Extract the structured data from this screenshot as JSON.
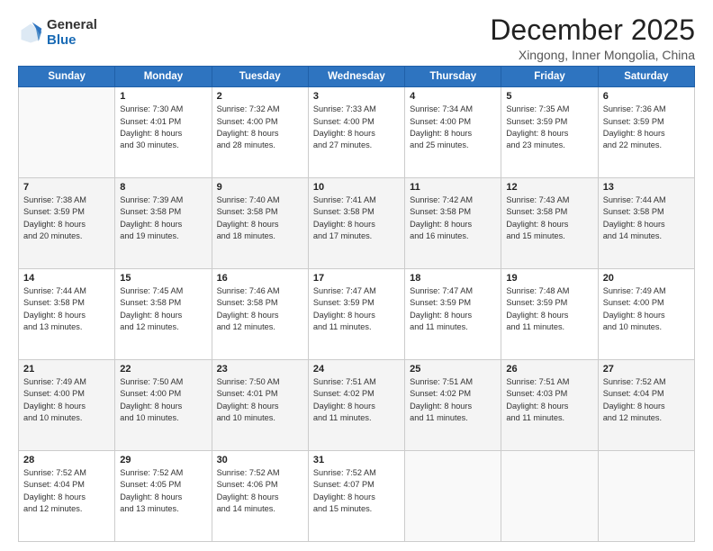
{
  "logo": {
    "general": "General",
    "blue": "Blue"
  },
  "title": "December 2025",
  "location": "Xingong, Inner Mongolia, China",
  "weekdays": [
    "Sunday",
    "Monday",
    "Tuesday",
    "Wednesday",
    "Thursday",
    "Friday",
    "Saturday"
  ],
  "weeks": [
    [
      {
        "num": "",
        "info": ""
      },
      {
        "num": "1",
        "info": "Sunrise: 7:30 AM\nSunset: 4:01 PM\nDaylight: 8 hours\nand 30 minutes."
      },
      {
        "num": "2",
        "info": "Sunrise: 7:32 AM\nSunset: 4:00 PM\nDaylight: 8 hours\nand 28 minutes."
      },
      {
        "num": "3",
        "info": "Sunrise: 7:33 AM\nSunset: 4:00 PM\nDaylight: 8 hours\nand 27 minutes."
      },
      {
        "num": "4",
        "info": "Sunrise: 7:34 AM\nSunset: 4:00 PM\nDaylight: 8 hours\nand 25 minutes."
      },
      {
        "num": "5",
        "info": "Sunrise: 7:35 AM\nSunset: 3:59 PM\nDaylight: 8 hours\nand 23 minutes."
      },
      {
        "num": "6",
        "info": "Sunrise: 7:36 AM\nSunset: 3:59 PM\nDaylight: 8 hours\nand 22 minutes."
      }
    ],
    [
      {
        "num": "7",
        "info": "Sunrise: 7:38 AM\nSunset: 3:59 PM\nDaylight: 8 hours\nand 20 minutes."
      },
      {
        "num": "8",
        "info": "Sunrise: 7:39 AM\nSunset: 3:58 PM\nDaylight: 8 hours\nand 19 minutes."
      },
      {
        "num": "9",
        "info": "Sunrise: 7:40 AM\nSunset: 3:58 PM\nDaylight: 8 hours\nand 18 minutes."
      },
      {
        "num": "10",
        "info": "Sunrise: 7:41 AM\nSunset: 3:58 PM\nDaylight: 8 hours\nand 17 minutes."
      },
      {
        "num": "11",
        "info": "Sunrise: 7:42 AM\nSunset: 3:58 PM\nDaylight: 8 hours\nand 16 minutes."
      },
      {
        "num": "12",
        "info": "Sunrise: 7:43 AM\nSunset: 3:58 PM\nDaylight: 8 hours\nand 15 minutes."
      },
      {
        "num": "13",
        "info": "Sunrise: 7:44 AM\nSunset: 3:58 PM\nDaylight: 8 hours\nand 14 minutes."
      }
    ],
    [
      {
        "num": "14",
        "info": "Sunrise: 7:44 AM\nSunset: 3:58 PM\nDaylight: 8 hours\nand 13 minutes."
      },
      {
        "num": "15",
        "info": "Sunrise: 7:45 AM\nSunset: 3:58 PM\nDaylight: 8 hours\nand 12 minutes."
      },
      {
        "num": "16",
        "info": "Sunrise: 7:46 AM\nSunset: 3:58 PM\nDaylight: 8 hours\nand 12 minutes."
      },
      {
        "num": "17",
        "info": "Sunrise: 7:47 AM\nSunset: 3:59 PM\nDaylight: 8 hours\nand 11 minutes."
      },
      {
        "num": "18",
        "info": "Sunrise: 7:47 AM\nSunset: 3:59 PM\nDaylight: 8 hours\nand 11 minutes."
      },
      {
        "num": "19",
        "info": "Sunrise: 7:48 AM\nSunset: 3:59 PM\nDaylight: 8 hours\nand 11 minutes."
      },
      {
        "num": "20",
        "info": "Sunrise: 7:49 AM\nSunset: 4:00 PM\nDaylight: 8 hours\nand 10 minutes."
      }
    ],
    [
      {
        "num": "21",
        "info": "Sunrise: 7:49 AM\nSunset: 4:00 PM\nDaylight: 8 hours\nand 10 minutes."
      },
      {
        "num": "22",
        "info": "Sunrise: 7:50 AM\nSunset: 4:00 PM\nDaylight: 8 hours\nand 10 minutes."
      },
      {
        "num": "23",
        "info": "Sunrise: 7:50 AM\nSunset: 4:01 PM\nDaylight: 8 hours\nand 10 minutes."
      },
      {
        "num": "24",
        "info": "Sunrise: 7:51 AM\nSunset: 4:02 PM\nDaylight: 8 hours\nand 11 minutes."
      },
      {
        "num": "25",
        "info": "Sunrise: 7:51 AM\nSunset: 4:02 PM\nDaylight: 8 hours\nand 11 minutes."
      },
      {
        "num": "26",
        "info": "Sunrise: 7:51 AM\nSunset: 4:03 PM\nDaylight: 8 hours\nand 11 minutes."
      },
      {
        "num": "27",
        "info": "Sunrise: 7:52 AM\nSunset: 4:04 PM\nDaylight: 8 hours\nand 12 minutes."
      }
    ],
    [
      {
        "num": "28",
        "info": "Sunrise: 7:52 AM\nSunset: 4:04 PM\nDaylight: 8 hours\nand 12 minutes."
      },
      {
        "num": "29",
        "info": "Sunrise: 7:52 AM\nSunset: 4:05 PM\nDaylight: 8 hours\nand 13 minutes."
      },
      {
        "num": "30",
        "info": "Sunrise: 7:52 AM\nSunset: 4:06 PM\nDaylight: 8 hours\nand 14 minutes."
      },
      {
        "num": "31",
        "info": "Sunrise: 7:52 AM\nSunset: 4:07 PM\nDaylight: 8 hours\nand 15 minutes."
      },
      {
        "num": "",
        "info": ""
      },
      {
        "num": "",
        "info": ""
      },
      {
        "num": "",
        "info": ""
      }
    ]
  ]
}
